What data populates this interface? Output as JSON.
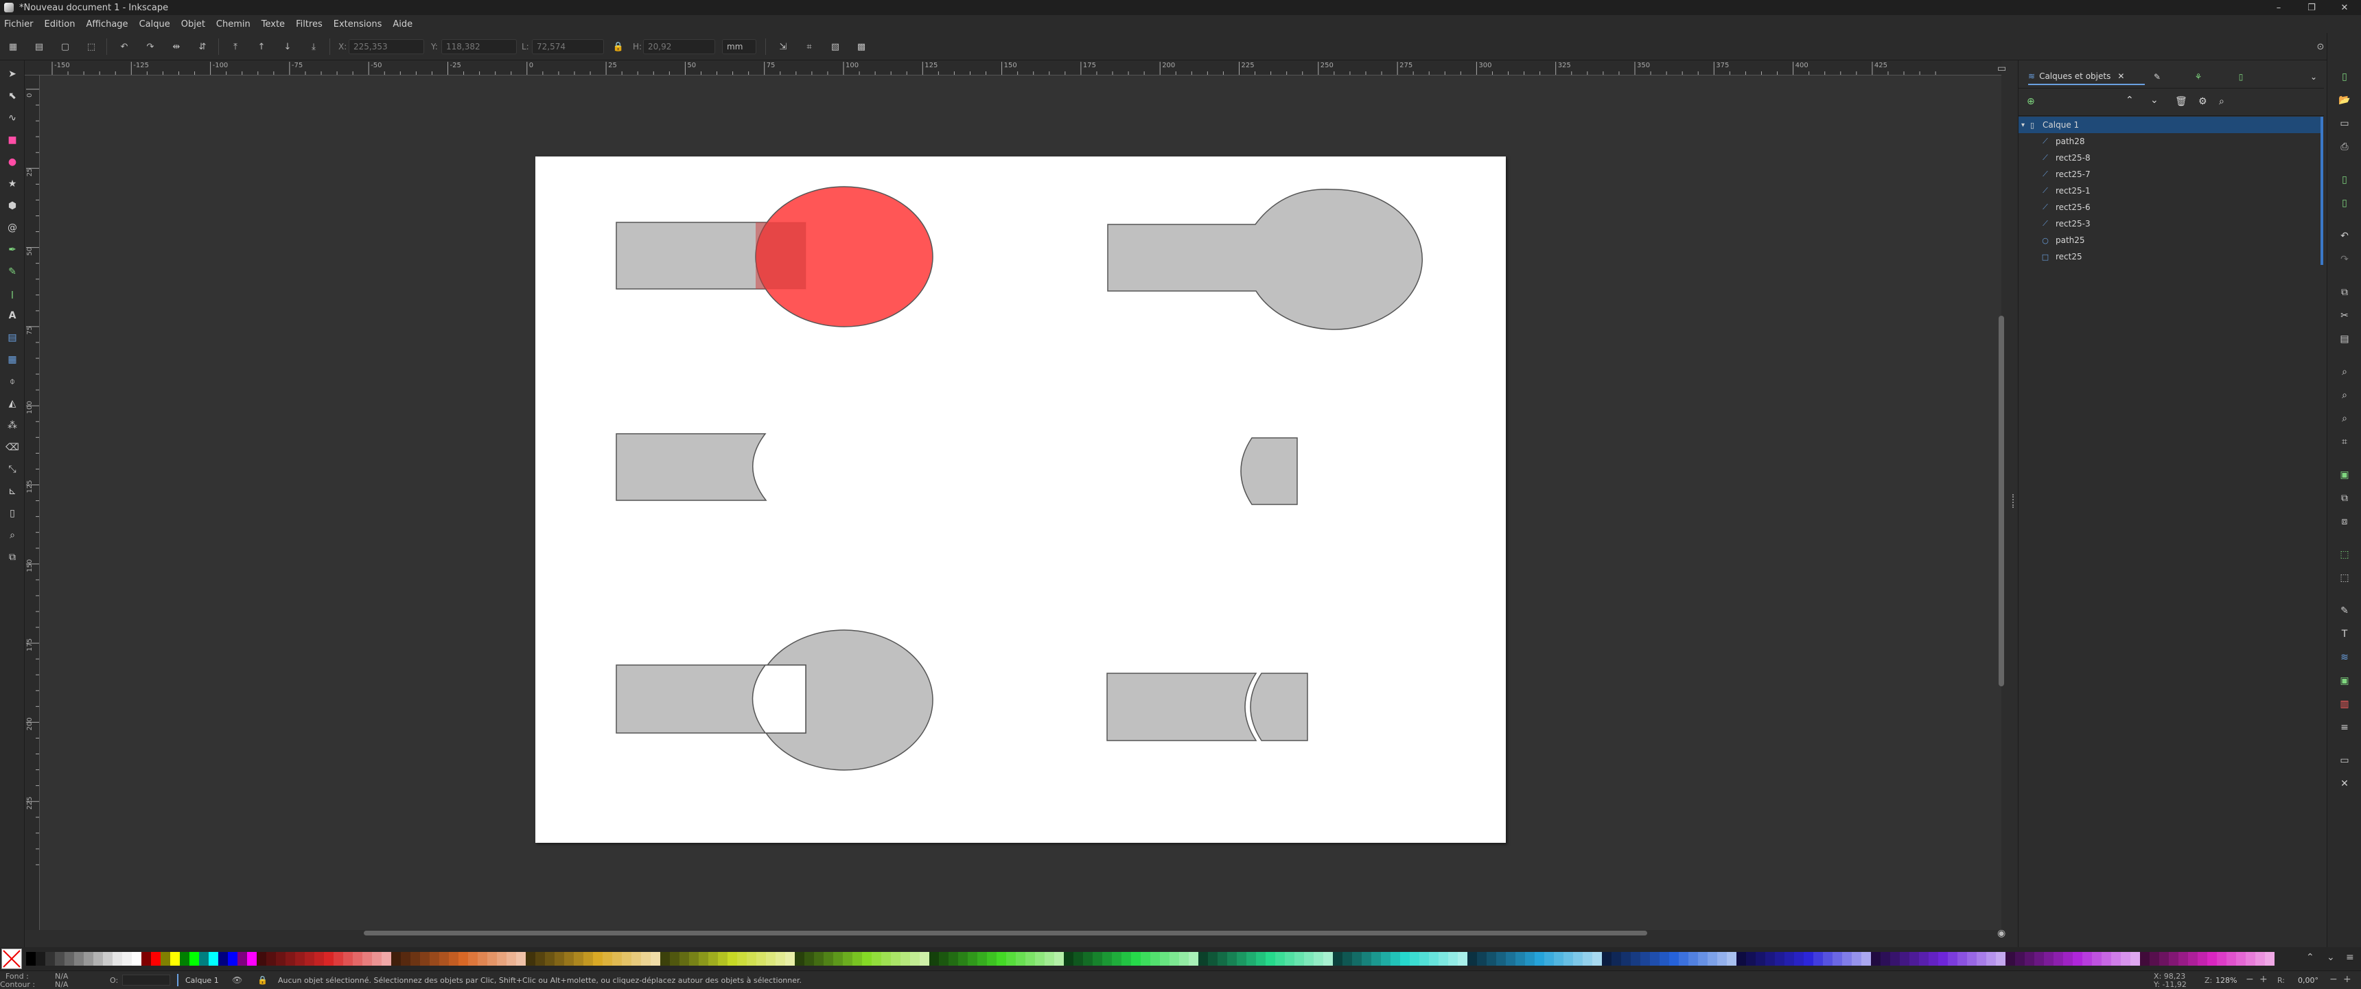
{
  "window": {
    "title": "*Nouveau document 1 - Inkscape",
    "controls": [
      "–",
      "❐",
      "✕"
    ]
  },
  "menu": [
    "Fichier",
    "Edition",
    "Affichage",
    "Calque",
    "Objet",
    "Chemin",
    "Texte",
    "Filtres",
    "Extensions",
    "Aide"
  ],
  "toolcontrols": {
    "x_label": "X:",
    "x_value": "225,353",
    "y_label": "Y:",
    "y_value": "118,382",
    "w_label": "L:",
    "w_value": "72,574",
    "h_label": "H:",
    "h_value": "20,92",
    "unit": "mm"
  },
  "ruler": {
    "top": [
      "-150",
      "-125",
      "-100",
      "-75",
      "-50",
      "-25",
      "0",
      "25",
      "50",
      "75",
      "100",
      "125",
      "150",
      "175",
      "200",
      "225",
      "250",
      "275",
      "300",
      "325",
      "350",
      "375",
      "400",
      "425"
    ],
    "left": [
      "0",
      "25",
      "50",
      "75",
      "100",
      "125",
      "150",
      "175",
      "200",
      "225"
    ]
  },
  "panel": {
    "tab_label": "Calques et objets",
    "layer": "Calque 1",
    "objects": [
      {
        "name": "path28",
        "icon": "path"
      },
      {
        "name": "rect25-8",
        "icon": "path"
      },
      {
        "name": "rect25-7",
        "icon": "path"
      },
      {
        "name": "rect25-1",
        "icon": "path"
      },
      {
        "name": "rect25-6",
        "icon": "path"
      },
      {
        "name": "rect25-3",
        "icon": "path"
      },
      {
        "name": "path25",
        "icon": "circle"
      },
      {
        "name": "rect25",
        "icon": "rect"
      }
    ]
  },
  "status": {
    "fill_label": "Fond :",
    "fill_value": "N/A",
    "stroke_label": "Contour :",
    "stroke_value": "N/A",
    "opacity_label": "O:",
    "layer": "Calque 1",
    "message": "Aucun objet sélectionné. Sélectionnez des objets par Clic, Shift+Clic ou Alt+molette, ou cliquez-déplacez autour des objets à sélectionner.",
    "x_coord": "X: 98,23",
    "y_coord": "Y: -11,92",
    "zoom_label": "Z:",
    "zoom": "128%",
    "rotation_label": "R:",
    "rotation": "0,00°"
  },
  "colors": {
    "red_shape": "#ff4d4d",
    "gray_shape": "#c0c0c0",
    "selection": "#1f4a78"
  }
}
